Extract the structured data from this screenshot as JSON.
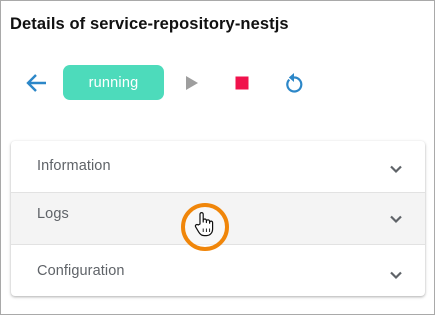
{
  "page": {
    "title": "Details of service-repository-nestjs"
  },
  "toolbar": {
    "status": "running",
    "colors": {
      "back": "#2c87c8",
      "status_bg": "#4ddbbb",
      "play": "#9e9e9e",
      "stop": "#f0124c",
      "restart": "#2c87c8"
    },
    "icons": {
      "back": "arrow-left-icon",
      "play": "play-icon",
      "stop": "stop-icon",
      "restart": "restart-icon"
    }
  },
  "accordion": {
    "items": [
      {
        "label": "Information",
        "icon": "chevron-down-icon"
      },
      {
        "label": "Logs",
        "icon": "chevron-down-icon"
      },
      {
        "label": "Configuration",
        "icon": "chevron-down-icon"
      }
    ]
  },
  "pointer": {
    "icon": "hand-pointer-icon",
    "highlight_color": "#f0860a"
  }
}
